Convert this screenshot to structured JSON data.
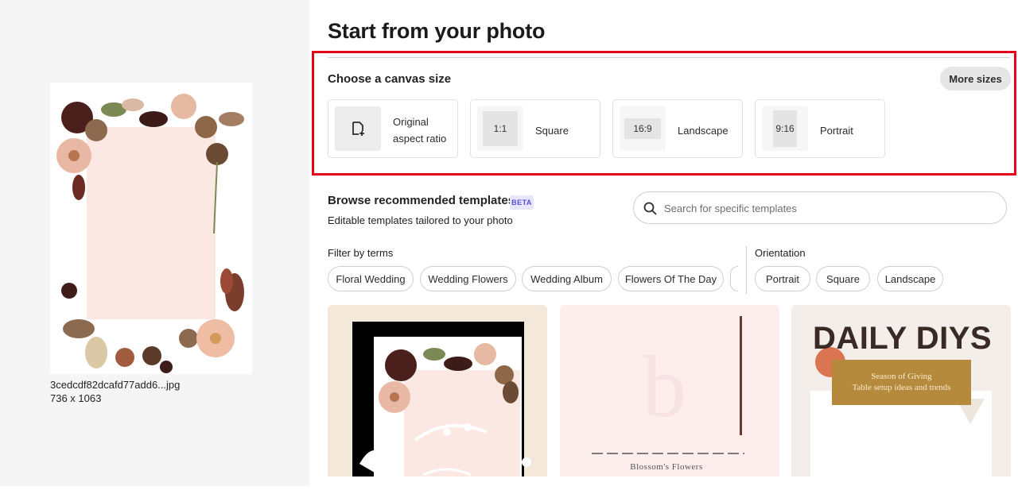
{
  "file": {
    "name": "3cedcdf82dcafd77add6...jpg",
    "dimensions": "736 x 1063"
  },
  "title": "Start from your photo",
  "canvas": {
    "heading": "Choose a canvas size",
    "more_sizes": "More sizes",
    "options": [
      {
        "label": "Original aspect ratio",
        "ratio": "",
        "icon": "add-image-icon"
      },
      {
        "label": "Square",
        "ratio": "1:1"
      },
      {
        "label": "Landscape",
        "ratio": "16:9"
      },
      {
        "label": "Portrait",
        "ratio": "9:16"
      }
    ]
  },
  "browse": {
    "heading": "Browse recommended templates",
    "badge": "BETA",
    "subtitle": "Editable templates tailored to your photo"
  },
  "search": {
    "placeholder": "Search for specific templates",
    "icon": "search-icon"
  },
  "filters": {
    "label": "Filter by terms",
    "terms": [
      "Floral Wedding",
      "Wedding Flowers",
      "Wedding Album",
      "Flowers Of The Day"
    ]
  },
  "orientation": {
    "label": "Orientation",
    "options": [
      "Portrait",
      "Square",
      "Landscape"
    ]
  },
  "templates": [
    {
      "type": "floral-photo"
    },
    {
      "type": "blossom",
      "caption": "Blossom's Flowers"
    },
    {
      "type": "daily-diys",
      "heading": "DAILY DIYS",
      "line1": "Season of Giving",
      "line2": "Table setup ideas and trends"
    }
  ],
  "colors": {
    "highlight_border": "#e3001b",
    "beta_bg": "#e8e6fb",
    "beta_text": "#5c4fd9"
  }
}
